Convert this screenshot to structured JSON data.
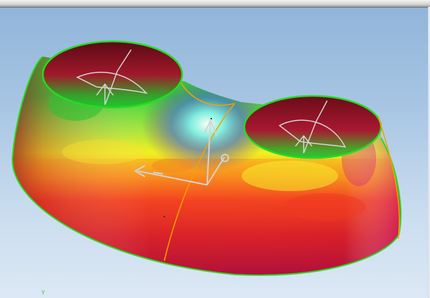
{
  "viewport": {
    "axis_label": "Y",
    "background_top": "#8fb4d8",
    "background_bottom": "#dce8f4",
    "edge_color": "#22dd22",
    "seam_color": "#f5a000",
    "triad_color": "#cfcfcf"
  }
}
